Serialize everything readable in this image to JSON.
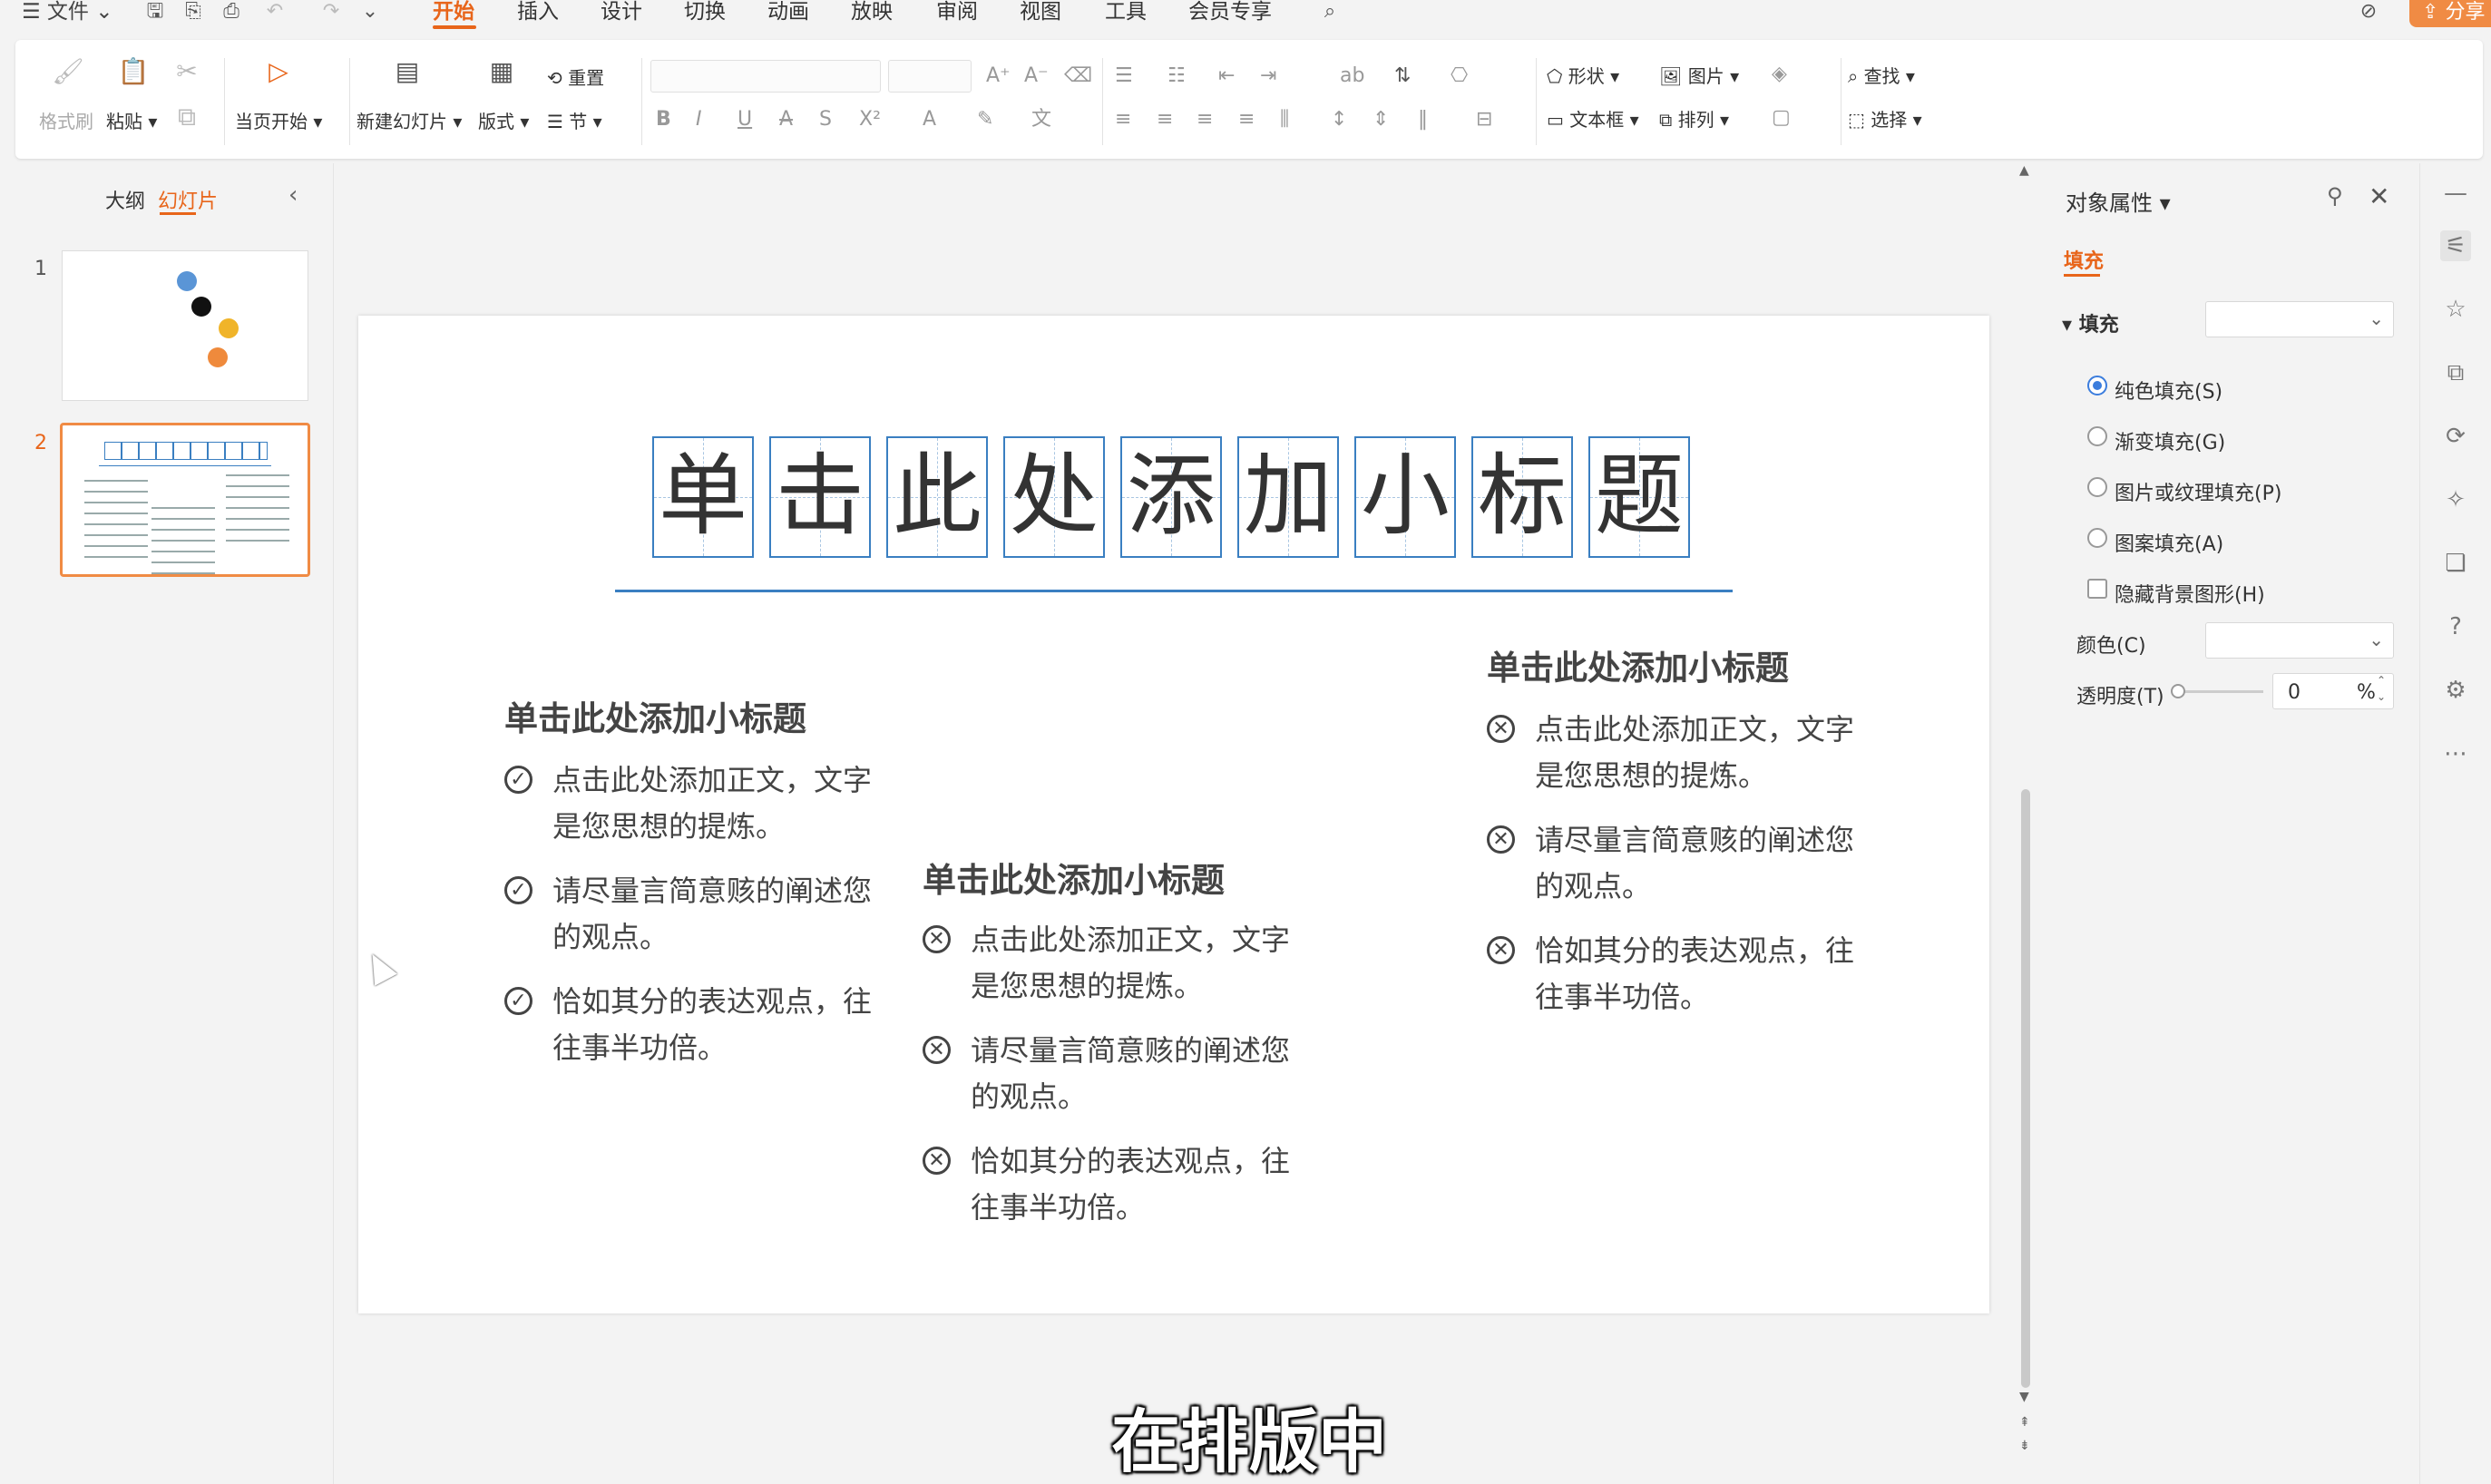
{
  "menubar": {
    "file_label": "☰ 文件 ⌄",
    "tabs": [
      "开始",
      "插入",
      "设计",
      "切换",
      "动画",
      "放映",
      "审阅",
      "视图",
      "工具",
      "会员专享"
    ],
    "share_label": "分享"
  },
  "ribbon": {
    "format_painter": "格式刷",
    "paste": "粘贴 ▾",
    "play_from_current": "当页开始 ▾",
    "new_slide": "新建幻灯片 ▾",
    "layout": "版式 ▾",
    "reset": "重置",
    "section": "节 ▾",
    "shape": "形状 ▾",
    "picture": "图片 ▾",
    "textbox": "文本框 ▾",
    "arrange": "排列 ▾",
    "find": "查找 ▾",
    "select": "选择 ▾"
  },
  "left_panel": {
    "tab_outline": "大纲",
    "tab_slides": "幻灯片",
    "slide_numbers": [
      "1",
      "2"
    ]
  },
  "slide": {
    "title_chars": [
      "单",
      "击",
      "此",
      "处",
      "添",
      "加",
      "小",
      "标",
      "题"
    ],
    "columns": [
      {
        "subtitle": "单击此处添加小标题",
        "icon": "check-circle-icon",
        "bullets": [
          "点击此处添加正文，文字是您思想的提炼。",
          "请尽量言简意赅的阐述您的观点。",
          "恰如其分的表达观点，往往事半功倍。"
        ]
      },
      {
        "subtitle": "单击此处添加小标题",
        "icon": "x-circle-icon",
        "bullets": [
          "点击此处添加正文，文字是您思想的提炼。",
          "请尽量言简意赅的阐述您的观点。",
          "恰如其分的表达观点，往往事半功倍。"
        ]
      },
      {
        "subtitle": "单击此处添加小标题",
        "icon": "x-circle-icon",
        "bullets": [
          "点击此处添加正文，文字是您思想的提炼。",
          "请尽量言简意赅的阐述您的观点。",
          "恰如其分的表达观点，往往事半功倍。"
        ]
      }
    ]
  },
  "properties": {
    "title": "对象属性 ▾",
    "tab_fill": "填充",
    "section_fill": "▾ 填充",
    "opt_solid": "纯色填充(S)",
    "opt_gradient": "渐变填充(G)",
    "opt_picture": "图片或纹理填充(P)",
    "opt_pattern": "图案填充(A)",
    "opt_hide_bg": "隐藏背景图形(H)",
    "color_label": "颜色(C)",
    "transparency_label": "透明度(T)",
    "transparency_value": "0",
    "percent": "%"
  },
  "caption": "在排版中",
  "colors": {
    "accent": "#e8651a",
    "title_box": "#3a7fc1",
    "radio_on": "#3b7ddd",
    "dot_blue": "#5a95d6",
    "dot_black": "#111111",
    "dot_yellow": "#f0b429",
    "dot_orange": "#ef8a3c"
  }
}
